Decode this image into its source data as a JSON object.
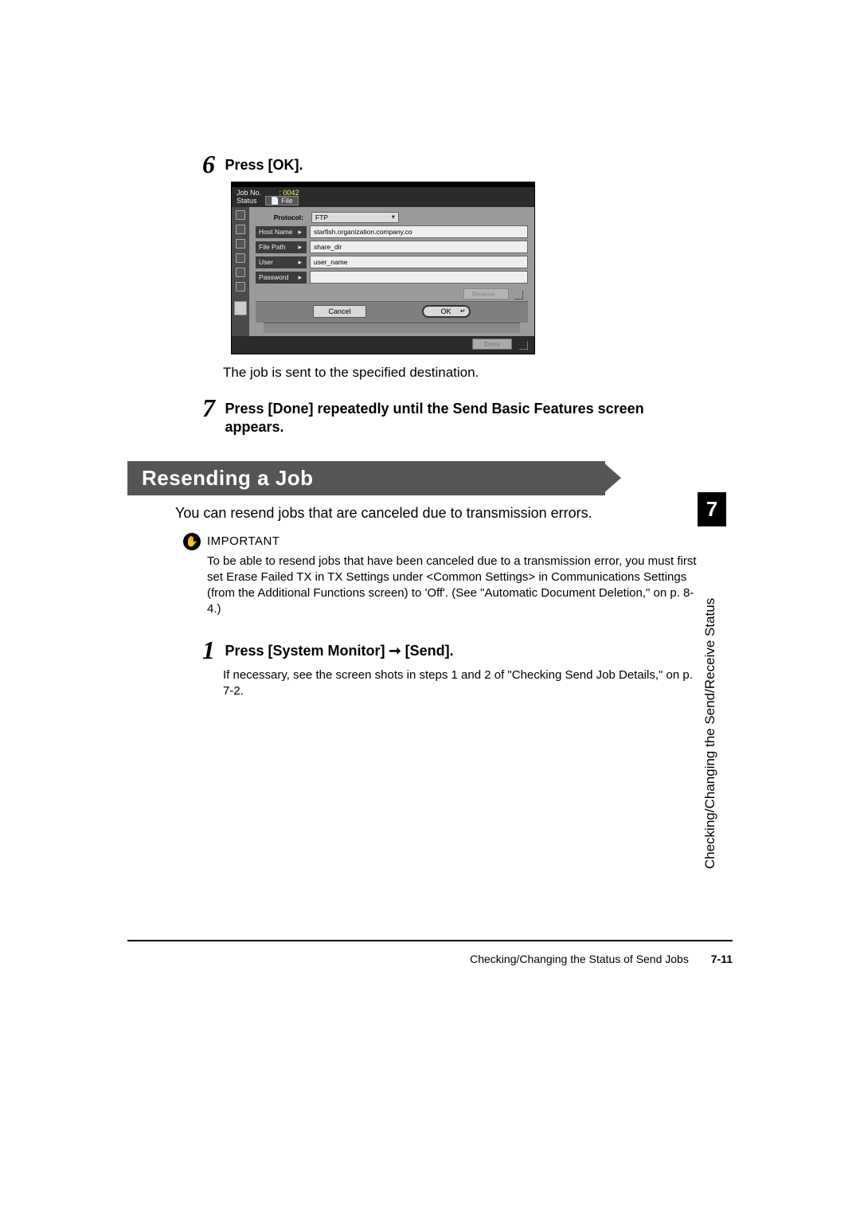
{
  "steps": {
    "s6": {
      "num": "6",
      "title": "Press [OK].",
      "caption": "The job is sent to the specified destination."
    },
    "s7": {
      "num": "7",
      "title": "Press [Done] repeatedly until the Send Basic Features screen appears."
    },
    "s1": {
      "num": "1",
      "title": "Press [System Monitor] ➞ [Send].",
      "body": "If necessary, see the screen shots in steps 1 and 2 of \"Checking Send Job Details,\" on p. 7-2."
    }
  },
  "section": {
    "heading": "Resending a Job",
    "intro": "You can resend jobs that are canceled due to transmission errors.",
    "important_label": "IMPORTANT",
    "important_body": "To be able to resend jobs that have been canceled due to a transmission error, you must first set Erase Failed TX in TX Settings under <Common Settings> in Communications Settings (from the Additional Functions screen) to 'Off'. (See \"Automatic Document Deletion,\" on p. 8-4.)"
  },
  "sidetab": {
    "num": "7",
    "text": "Checking/Changing the Send/Receive Status"
  },
  "footer": {
    "title": "Checking/Changing the Status of Send Jobs",
    "page": "7-11"
  },
  "shot": {
    "jobno_label": "Job No.",
    "jobno_value": ": 0042",
    "status_label": "Status",
    "file_label": "File",
    "protocol_label": "Protocol:",
    "protocol_value": "FTP",
    "host_label": "Host Name",
    "host_value": "starfish.organization.company.co",
    "path_label": "File Path",
    "path_value": "share_dir",
    "user_label": "User",
    "user_value": "user_name",
    "pwd_label": "Password",
    "pwd_value": "",
    "browse": "Browse...",
    "cancel": "Cancel",
    "ok": "OK",
    "done": "Done"
  }
}
